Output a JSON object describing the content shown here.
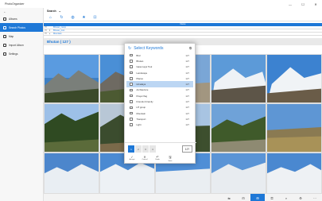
{
  "window": {
    "title": "PhotoOrganizer",
    "controls": [
      "—",
      "☐",
      "✕"
    ]
  },
  "sidebar": {
    "back": "←",
    "items": [
      {
        "label": "Albums",
        "icon": "albums-icon",
        "active": false
      },
      {
        "label": "Search Photos",
        "icon": "search-icon",
        "active": true
      },
      {
        "label": "Map",
        "icon": "map-icon",
        "active": false
      },
      {
        "label": "Import Album",
        "icon": "import-icon",
        "active": false
      },
      {
        "label": "Settings",
        "icon": "gear-icon",
        "active": false
      }
    ]
  },
  "search": {
    "label": "Search",
    "toolbar_icons": [
      "home-icon",
      "refresh-icon",
      "globe-icon",
      "star-icon",
      "tag-icon"
    ]
  },
  "grid": {
    "header": "Name",
    "rows": [
      {
        "c1": "☐",
        "c2": "",
        "text": "Bhutan_camp"
      },
      {
        "c1": "☐",
        "c2": "×",
        "text": "Bhutan_trek"
      },
      {
        "c1": "☐",
        "c2": "+",
        "text": "Mountain"
      }
    ]
  },
  "group": {
    "title": "Bhutan ( 127 )"
  },
  "popup": {
    "title": "Select Keywords",
    "keywords": [
      {
        "label": "Bird",
        "count": "127",
        "selected": false
      },
      {
        "label": "Bhutan",
        "count": "127",
        "selected": false
      },
      {
        "label": "Gasa Laya Trek",
        "count": "127",
        "selected": false
      },
      {
        "label": "Landscape",
        "count": "127",
        "selected": false
      },
      {
        "label": "Places",
        "count": "127",
        "selected": false
      },
      {
        "label": "Himalaya",
        "count": "127",
        "selected": true
      },
      {
        "label": "Architecture",
        "count": "127",
        "selected": false
      },
      {
        "label": "Prayer flag",
        "count": "127",
        "selected": false
      },
      {
        "label": "Friends & Family",
        "count": "127",
        "selected": false
      },
      {
        "label": "HT group",
        "count": "127",
        "selected": false
      },
      {
        "label": "Mountain",
        "count": "127",
        "selected": false
      },
      {
        "label": "Transport",
        "count": "127",
        "selected": false
      },
      {
        "label": "Light",
        "count": "127",
        "selected": false
      }
    ],
    "segments": [
      "1",
      "2",
      "3",
      "4"
    ],
    "count": "127",
    "actions": [
      {
        "icon": "✓",
        "label": "Accept"
      },
      {
        "icon": "✕",
        "label": "Cancel"
      },
      {
        "icon": "↶",
        "label": "Undo"
      },
      {
        "icon": "🖫",
        "label": "Save"
      }
    ],
    "close": "⧉"
  },
  "bottombar": {
    "buttons": [
      "⇆",
      "⊟",
      "⊞",
      "⚿",
      "⌕",
      "⚙",
      "⋯"
    ],
    "active_index": 2
  },
  "colors": {
    "accent": "#1e78d7"
  }
}
